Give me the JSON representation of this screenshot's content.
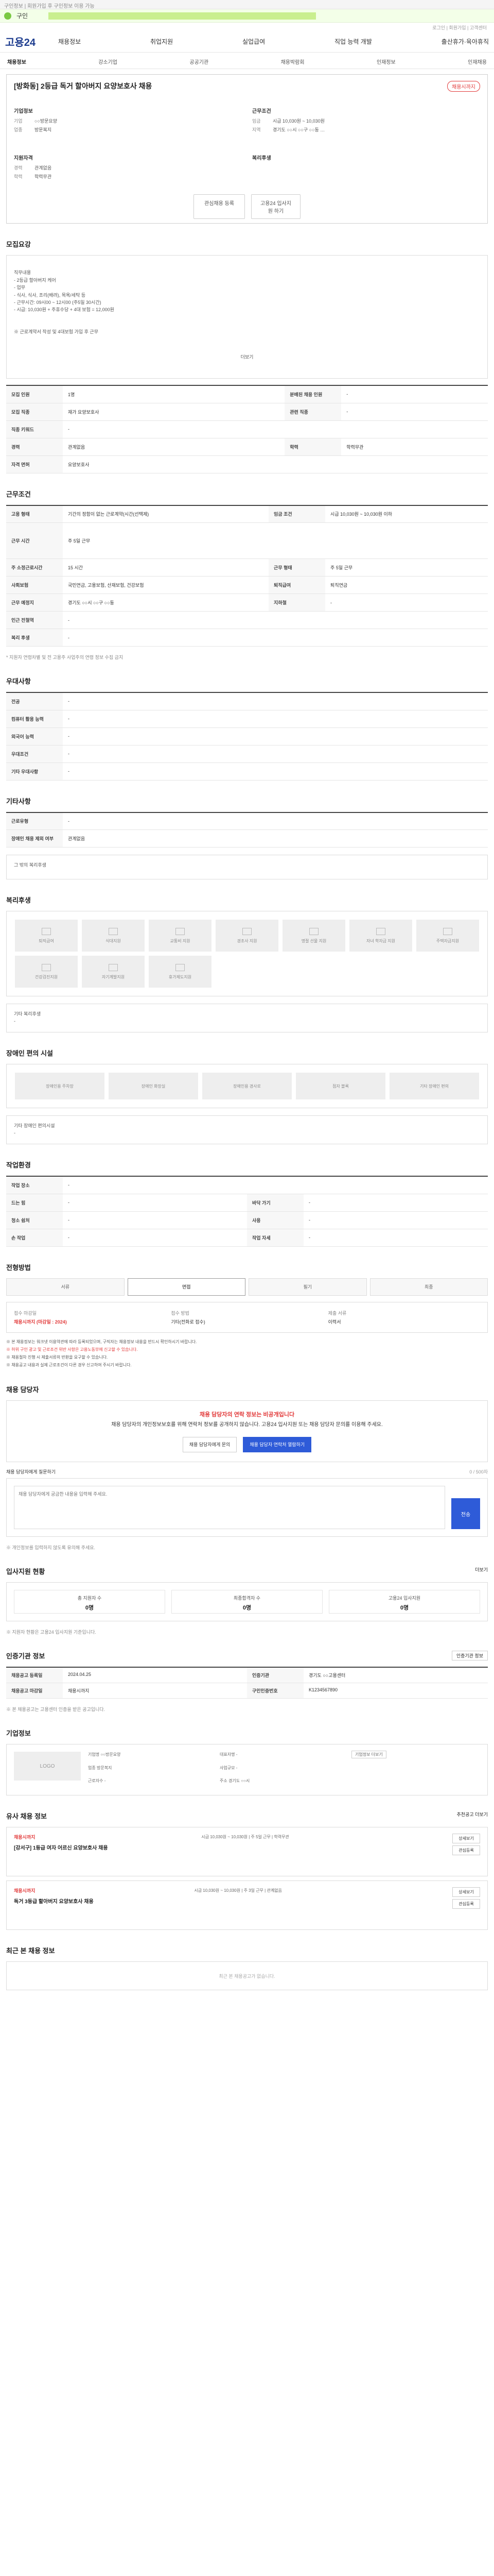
{
  "topbar": {
    "text": "구인정보 | 회원가입 후 구인정보 이용 가능"
  },
  "notice": {
    "label": "구인"
  },
  "util": {
    "links": "로그인 | 회원가입 | 고객센터"
  },
  "header": {
    "logo": "고용24",
    "gnb": [
      "채용정보",
      "취업지원",
      "실업급여",
      "직업 능력 개발",
      "출산휴가·육아휴직"
    ]
  },
  "subnav": [
    "채용정보",
    "강소기업",
    "공공기관",
    "채용박람회",
    "인재정보",
    "인재채용"
  ],
  "job": {
    "title": "[방화동] 2등급 독거 할아버지 요양보호사 채용",
    "badge": "채용시까지",
    "company_h": "기업정보",
    "company_rows": [
      [
        "기업",
        "○○방문요양"
      ],
      [
        "업종",
        "방문복지"
      ]
    ],
    "cond_h": "근무조건",
    "cond_rows": [
      [
        "임금",
        "시급 10,030원 ~ 10,030원"
      ],
      [
        "지역",
        "경기도 ○○시 ○○구 ○○동 …"
      ]
    ],
    "req_h": "지원자격",
    "req_rows": [
      [
        "경력",
        "관계없음"
      ],
      [
        "학력",
        "학력무관"
      ]
    ],
    "welfare_h": "복리후생",
    "btn_interest": "관심채용 등록",
    "btn_apply": "고용24 입사지원 하기"
  },
  "detail": {
    "title": "모집요강",
    "body": "직무내용\n- 2등급 할아버지 케어\n- 업무\n- 식사, 식사, 조리(배려), 목욕/세탁 등\n- 근무시간: 09시00 ~ 12시00 (주5일 30시간)\n- 시급: 10,030원 + 주휴수당 + 4대 보험 = 12,000원",
    "note": "※ 근로계약서 작성 및 4대보험 가입 후 근무",
    "more": "더보기"
  },
  "table1": [
    [
      "모집 인원",
      "1명",
      "분배된 채용 인원",
      "-"
    ],
    [
      "모집 직종",
      "재가 요양보호사",
      "관련 직종",
      "-"
    ],
    [
      "직종 키워드",
      "-",
      "",
      ""
    ],
    [
      "경력",
      "관계없음",
      "학력",
      "학력무관"
    ],
    [
      "자격 면허",
      "요양보호사",
      "",
      ""
    ]
  ],
  "work": {
    "title": "근무조건",
    "rows": [
      [
        "고용 형태",
        "기간의 정함이 없는 근로계약(시간(선택제)",
        "임금 조건",
        "시급 10,030원 ~ 10,030원 이하"
      ],
      [
        "근무 시간",
        "주 5일 근무",
        "",
        ""
      ],
      [
        "주 소정근로시간",
        "15 시간",
        "근무 형태",
        "주 5일 근무"
      ],
      [
        "사회보험",
        "국민연금, 고용보험, 산재보험, 건강보험",
        "퇴직급여",
        "퇴직연금"
      ],
      [
        "근무 예정지",
        "경기도 ○○시 ○○구 ○○동",
        "지하철",
        "-"
      ],
      [
        "인근 전철역",
        "-",
        "",
        ""
      ],
      [
        "복리 후생",
        "-",
        "",
        ""
      ]
    ],
    "footnote": "* 지원자 연령차별 및 전 고용주 사업주의 연령 정보 수집 금지"
  },
  "prefer": {
    "title": "우대사항",
    "rows": [
      [
        "전공",
        "-"
      ],
      [
        "컴퓨터 활용 능력",
        "-"
      ],
      [
        "외국어 능력",
        "-"
      ],
      [
        "우대조건",
        "-"
      ],
      [
        "기타 우대사항",
        "-"
      ]
    ]
  },
  "etc": {
    "title": "기타사항",
    "rows": [
      [
        "근로유형",
        "-"
      ],
      [
        "장애인 채용 제외 여부",
        "관계없음"
      ]
    ],
    "sub": "그 밖의 복리후생"
  },
  "welfare": {
    "title": "복리후생",
    "items": [
      "퇴직급여",
      "식대지원",
      "교통비 지원",
      "경조사 지원",
      "명절 선물 지원",
      "자녀 학자금 지원",
      "주택자금지원",
      "건강검진지원",
      "자기계발지원",
      "휴가제도지원"
    ],
    "other_h": "기타 복리후생",
    "other_v": "-"
  },
  "disability": {
    "title": "장애인 편의 시설",
    "items": [
      "장애인용 주차장",
      "장애인 화장실",
      "장애인용 경사로",
      "점자 블록",
      "기타 장애인 편의"
    ],
    "other_h": "기타 장애인 편의시설",
    "other_v": "-"
  },
  "jobenv": {
    "title": "작업환경",
    "rows": [
      [
        "작업 장소",
        "-",
        "",
        ""
      ],
      [
        "드는 힘",
        "-",
        "바닥 가기",
        "-"
      ],
      [
        "청소 쉼처",
        "-",
        "사용",
        "-"
      ],
      [
        "손 작업",
        "-",
        "작업 자세",
        "-"
      ]
    ]
  },
  "process": {
    "title": "전형방법",
    "steps": [
      "서류",
      "면접",
      "필기",
      "최종"
    ],
    "info": [
      [
        "접수 마감일",
        "채용시까지 (마감일 : 2024)"
      ],
      [
        "접수 방법",
        "기타(전화로 접수)"
      ],
      [
        "제출 서류",
        "이력서"
      ]
    ],
    "notes": [
      "※ 본 채용정보는 워크넷 이용약관에 따라 등록되었으며, 구직자는 채용정보 내용을 반드시 확인하시기 바랍니다.",
      "※ 허위 구인 광고 및 근로조건 위반 사항은 고용노동부에 신고할 수 있습니다.",
      "※ 채용절차 진행 시 제출서류의 반환을 요구할 수 있습니다.",
      "※ 채용공고 내용과 실제 근로조건이 다른 경우 신고하여 주시기 바랍니다."
    ]
  },
  "contact": {
    "title": "채용 담당자",
    "alert_title": "채용 담당자의 연락 정보는 비공개입니다",
    "alert_body": "채용 담당자의 개인정보보호를 위해 연락처 정보를 공개하지 않습니다. 고용24 입사지원 또는 채용 담당자 문의를 이용해 주세요.",
    "btn1": "채용 담당자에게 문의",
    "btn2": "채용 담당자 연락처 열람하기"
  },
  "qa": {
    "title": "채용 담당자에게 질문하기",
    "counter": "0 / 500자",
    "placeholder": "채용 담당자에게 궁금한 내용을 입력해 주세요.",
    "send": "전송",
    "note": "※ 개인정보를 입력하지 않도록 유의해 주세요."
  },
  "applicants": {
    "title": "입사지원 현황",
    "more": "더보기",
    "stats": [
      [
        "총 지원자 수",
        "0명"
      ],
      [
        "최종합격자 수",
        "0명"
      ],
      [
        "고용24 입사지원",
        "0명"
      ]
    ],
    "note": "※ 지원자 현황은 고용24 입사지원 기준입니다."
  },
  "agency": {
    "title": "인증기관 정보",
    "btn": "인증기관 정보",
    "rows": [
      [
        "채용공고 등록일",
        "2024.04.25",
        "인증기관",
        "경기도 ○○고용센터"
      ],
      [
        "채용공고 마감일",
        "채용시까지",
        "구인인증번호",
        "K1234567890"
      ]
    ],
    "note": "※ 본 채용공고는 고용센터 인증을 받은 공고입니다."
  },
  "company": {
    "title": "기업정보",
    "logo": "LOGO",
    "fields": [
      [
        "기업명",
        "○○방문요양"
      ],
      [
        "대표자명",
        "-"
      ],
      [
        "업종",
        "방문복지"
      ],
      [
        "사업규모",
        "-"
      ],
      [
        "근로자수",
        "-"
      ],
      [
        "주소",
        "경기도 ○○시"
      ]
    ],
    "more": "기업정보 더보기"
  },
  "similar": {
    "title": "유사 채용 정보",
    "more": "추천공고 더보기",
    "items": [
      {
        "status": "채용시까지",
        "title": "[강서구] 1등급 여자 어르신 요양보호사 채용",
        "cond": "시급 10,030원 ~ 10,030원 | 주 5일 근무 | 학력무관",
        "b1": "상세보기",
        "b2": "관심등록"
      },
      {
        "status": "채용시까지",
        "title": "독거 3등급 할아버지 요양보호사 채용",
        "cond": "시급 10,030원 ~ 10,030원 | 주 3일 근무 | 관계없음",
        "b1": "상세보기",
        "b2": "관심등록"
      }
    ]
  },
  "empty": {
    "title": "최근 본 채용 정보",
    "text": "최근 본 채용공고가 없습니다."
  }
}
